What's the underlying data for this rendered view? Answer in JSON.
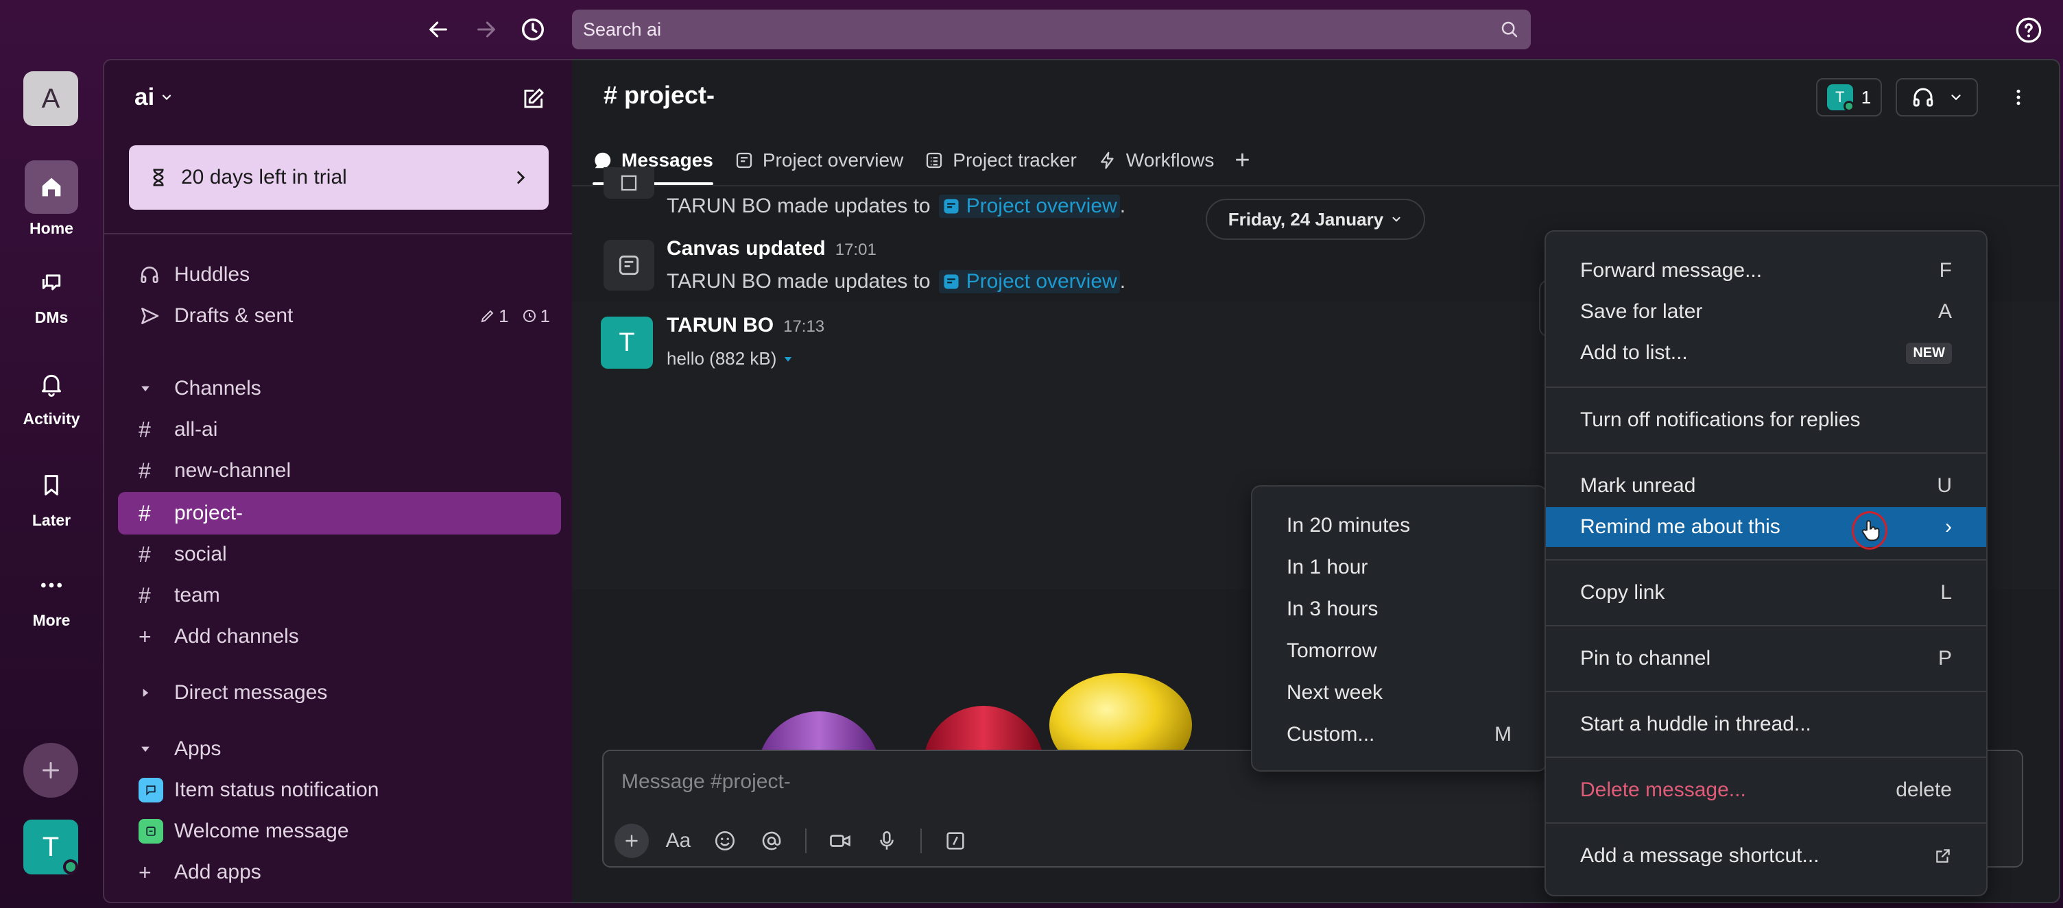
{
  "topbar": {
    "search_placeholder": "Search ai",
    "icons": [
      "back-arrow-icon",
      "forward-arrow-icon",
      "history-icon",
      "search-icon",
      "help-icon"
    ]
  },
  "rail": {
    "workspace_initial": "A",
    "items": [
      {
        "label": "Home",
        "icon": "home-icon",
        "active": true
      },
      {
        "label": "DMs",
        "icon": "dms-icon",
        "active": false
      },
      {
        "label": "Activity",
        "icon": "bell-icon",
        "active": false
      },
      {
        "label": "Later",
        "icon": "bookmark-icon",
        "active": false
      },
      {
        "label": "More",
        "icon": "more-icon",
        "active": false
      }
    ],
    "user_initial": "T"
  },
  "sidebar": {
    "workspace_name": "ai",
    "trial_text": "20 days left in trial",
    "huddles": "Huddles",
    "drafts": "Drafts & sent",
    "drafts_count": "1",
    "scheduled_count": "1",
    "channels_header": "Channels",
    "channels": [
      {
        "name": "all-ai",
        "active": false
      },
      {
        "name": "new-channel",
        "active": false
      },
      {
        "name": "project-",
        "active": true
      },
      {
        "name": "social",
        "active": false
      },
      {
        "name": "team",
        "active": false
      }
    ],
    "add_channels": "Add channels",
    "dm_header": "Direct messages",
    "apps_header": "Apps",
    "apps": [
      {
        "name": "Item status notification",
        "color": "#4fc3f7"
      },
      {
        "name": "Welcome message",
        "color": "#4ccf7a"
      }
    ],
    "add_apps": "Add apps"
  },
  "channel": {
    "title": "# project-",
    "member_count": "1",
    "member_initial": "T",
    "tabs": [
      {
        "label": "Messages",
        "active": true
      },
      {
        "label": "Project overview",
        "active": false
      },
      {
        "label": "Project tracker",
        "active": false
      },
      {
        "label": "Workflows",
        "active": false
      }
    ],
    "add_tab": "+"
  },
  "messages": {
    "update_line_1_prefix": "TARUN BO made updates to",
    "update_line_1_link": "Project overview",
    "date_pill": "Friday, 24 January",
    "canvas_author": "Canvas updated",
    "canvas_time": "17:01",
    "update_line_2_prefix": "TARUN BO made updates to",
    "update_line_2_link": "Project overview",
    "tarun_initial": "T",
    "tarun_author": "TARUN BO",
    "tarun_time": "17:13",
    "file_line": "hello (882 kB)",
    "period": "."
  },
  "composer": {
    "placeholder": "Message #project-",
    "format_label": "Aa"
  },
  "context_menu": {
    "items": [
      {
        "label": "Forward message...",
        "shortcut": "F"
      },
      {
        "label": "Save for later",
        "shortcut": "A"
      },
      {
        "label": "Add to list...",
        "badge": "NEW"
      },
      {
        "label": "Turn off notifications for replies",
        "shortcut": ""
      },
      {
        "label": "Mark unread",
        "shortcut": "U"
      },
      {
        "label": "Remind me about this",
        "shortcut": "›"
      },
      {
        "label": "Copy link",
        "shortcut": "L"
      },
      {
        "label": "Pin to channel",
        "shortcut": "P"
      },
      {
        "label": "Start a huddle in thread...",
        "shortcut": ""
      },
      {
        "label": "Delete message...",
        "shortcut": "delete"
      },
      {
        "label": "Add a message shortcut...",
        "shortcut": ""
      }
    ],
    "highlight_color": "#1264a3",
    "danger_color": "#e05b78"
  },
  "remind_submenu": {
    "items": [
      {
        "label": "In 20 minutes",
        "shortcut": ""
      },
      {
        "label": "In 1 hour",
        "shortcut": ""
      },
      {
        "label": "In 3 hours",
        "shortcut": ""
      },
      {
        "label": "Tomorrow",
        "shortcut": ""
      },
      {
        "label": "Next week",
        "shortcut": ""
      },
      {
        "label": "Custom...",
        "shortcut": "M"
      }
    ]
  }
}
